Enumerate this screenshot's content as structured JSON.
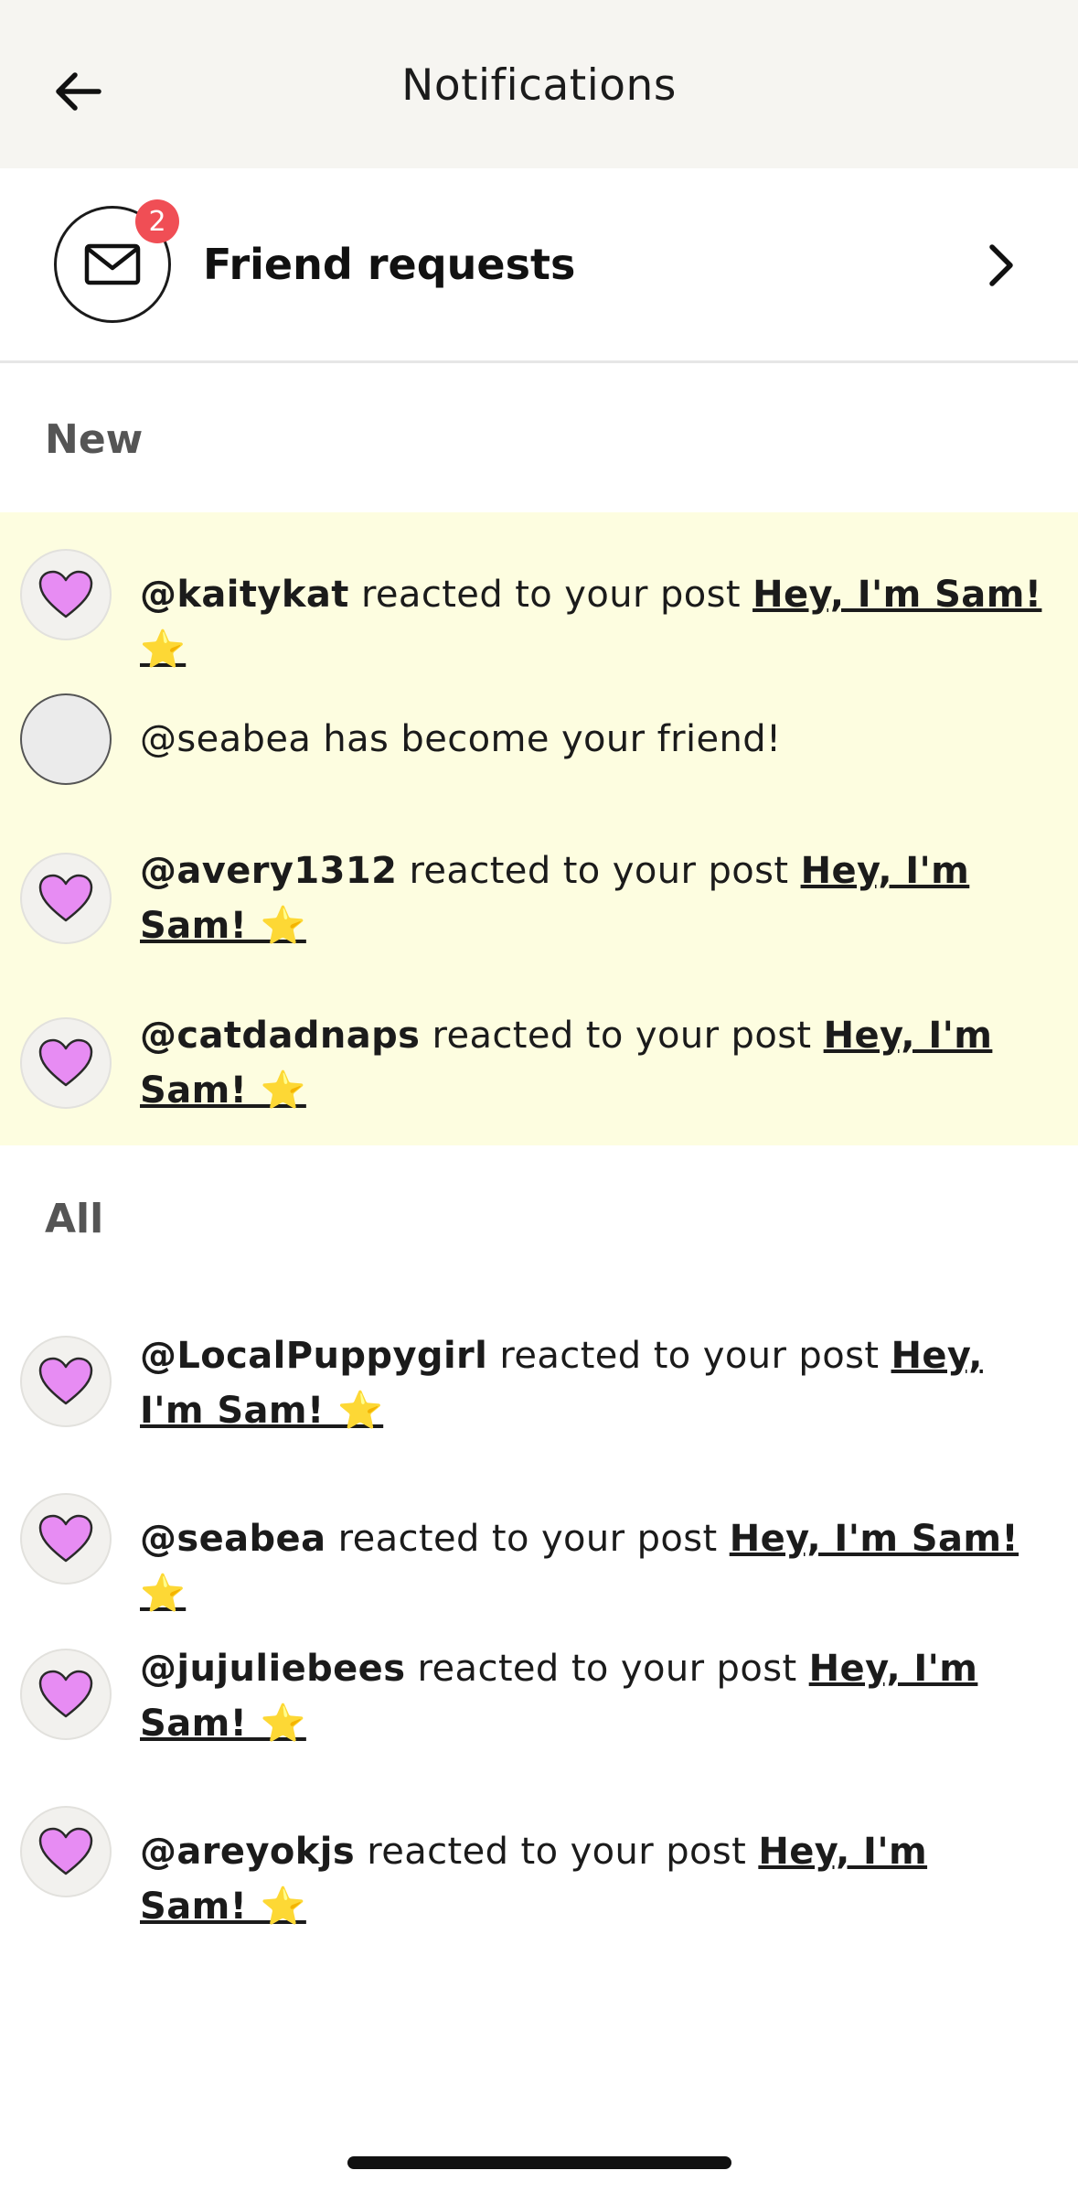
{
  "header": {
    "title": "Notifications",
    "back_icon": "arrow-left-icon"
  },
  "friend_requests": {
    "label": "Friend requests",
    "badge_count": "2",
    "icon": "mail-icon",
    "chevron_icon": "chevron-right-icon"
  },
  "sections": {
    "new_label": "New",
    "all_label": "All"
  },
  "new_items": [
    {
      "user": "@kaitykat",
      "text": " reacted to your post ",
      "post": "Hey, I'm Sam! ⭐",
      "icon": "heart-icon"
    },
    {
      "user": "",
      "text": "@seabea has become your friend!",
      "post": "",
      "icon": "avatar-placeholder"
    },
    {
      "user": "@avery1312",
      "text": " reacted to your post ",
      "post": "Hey, I'm Sam! ⭐",
      "icon": "heart-icon"
    },
    {
      "user": "@catdadnaps",
      "text": " reacted to your post ",
      "post": "Hey, I'm Sam! ⭐",
      "icon": "heart-icon"
    }
  ],
  "all_items": [
    {
      "user": "@LocalPuppygirl",
      "text": " reacted to your post ",
      "post": "Hey, I'm Sam! ⭐",
      "icon": "heart-icon"
    },
    {
      "user": "@seabea",
      "text": " reacted to your post ",
      "post": "Hey, I'm Sam! ⭐",
      "icon": "heart-icon"
    },
    {
      "user": "@jujuliebees",
      "text": " reacted to your post ",
      "post": "Hey, I'm Sam! ⭐",
      "icon": "heart-icon"
    },
    {
      "user": "@areyokjs",
      "text": " reacted to your post ",
      "post": "Hey, I'm Sam! ⭐",
      "icon": "heart-icon"
    }
  ],
  "colors": {
    "header_bg": "#f6f5f1",
    "new_bg": "#fdfde0",
    "badge": "#f04e55",
    "heart": "#e78cf3"
  }
}
